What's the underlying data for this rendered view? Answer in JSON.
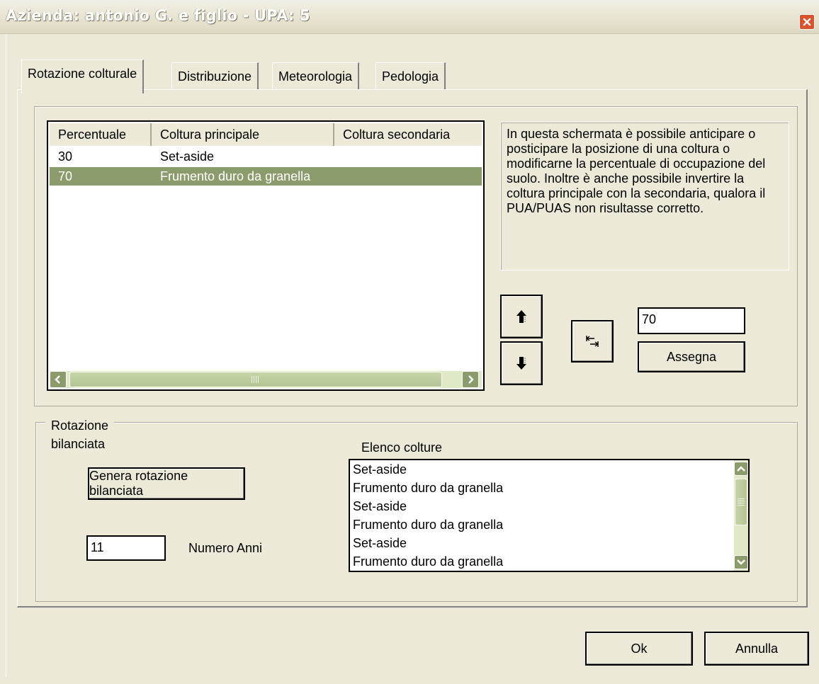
{
  "window": {
    "title": "Azienda: antonio G. e figlio - UPA: 5"
  },
  "tabs": [
    {
      "label": "Rotazione colturale",
      "active": true
    },
    {
      "label": "Distribuzione",
      "active": false
    },
    {
      "label": "Meteorologia",
      "active": false
    },
    {
      "label": "Pedologia",
      "active": false
    }
  ],
  "rotation_list": {
    "columns": [
      "Percentuale",
      "Coltura principale",
      "Coltura secondaria"
    ],
    "rows": [
      {
        "percentuale": "30",
        "principale": "Set-aside",
        "secondaria": "",
        "selected": false
      },
      {
        "percentuale": "70",
        "principale": "Frumento duro da granella",
        "secondaria": "",
        "selected": true
      }
    ]
  },
  "info_text": "In questa schermata è possibile anticipare o posticipare la posizione di una coltura o modificarne la percentuale di occupazione del suolo. Inoltre è anche possibile invertire la coltura principale con la secondaria, qualora il PUA/PUAS non risultasse corretto.",
  "controls": {
    "percent_value": "70",
    "assign_label": "Assegna",
    "move_up_icon": "arrow-up-icon",
    "move_down_icon": "arrow-down-icon",
    "swap_icon": "swap-crops-icon"
  },
  "balanced_rotation": {
    "group_label": "Rotazione bilanciata",
    "generate_label": "Genera rotazione bilanciata",
    "years_value": "11",
    "years_label": "Numero Anni",
    "list_label": "Elenco colture",
    "list_items": [
      "Set-aside",
      "Frumento duro da granella",
      "Set-aside",
      "Frumento duro da granella",
      "Set-aside",
      "Frumento duro da granella"
    ]
  },
  "footer": {
    "ok_label": "Ok",
    "cancel_label": "Annulla"
  },
  "colors": {
    "window_bg": "#ECE9D8",
    "selection": "#8C9B6C",
    "scrollbar": "#DFE9C8",
    "close_button": "#D8542E"
  }
}
